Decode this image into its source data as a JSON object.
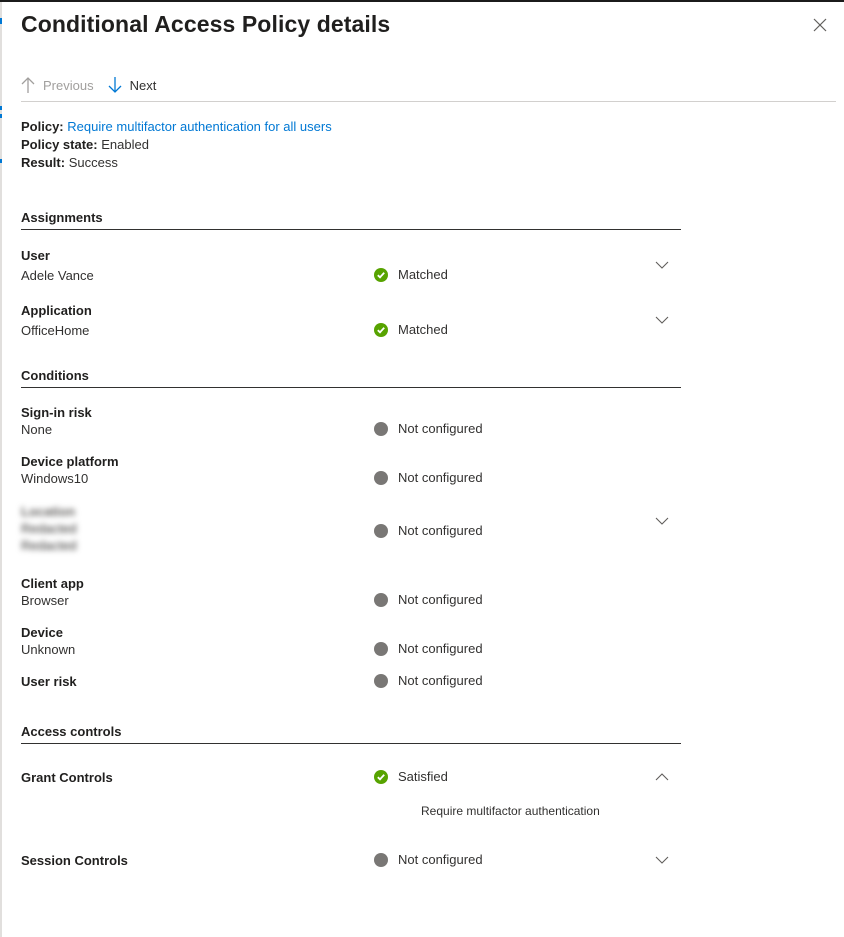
{
  "panel": {
    "title": "Conditional Access Policy details",
    "close_icon": "close-icon"
  },
  "nav": {
    "previous_label": "Previous",
    "previous_icon": "arrow-up-icon",
    "next_label": "Next",
    "next_icon": "arrow-down-icon"
  },
  "summary": {
    "policy_label": "Policy:",
    "policy_value": "Require multifactor authentication for all users",
    "state_label": "Policy state:",
    "state_value": "Enabled",
    "result_label": "Result:",
    "result_value": "Success"
  },
  "colors": {
    "accent": "#0078d4",
    "success": "#57a300",
    "not_configured": "#797775"
  },
  "assignments": {
    "heading": "Assignments",
    "rows": [
      {
        "label": "User",
        "value": "Adele Vance",
        "status": "Matched",
        "status_type": "success",
        "expandable": true,
        "expanded": false
      },
      {
        "label": "Application",
        "value": "OfficeHome",
        "status": "Matched",
        "status_type": "success",
        "expandable": true,
        "expanded": false
      }
    ]
  },
  "conditions": {
    "heading": "Conditions",
    "rows": [
      {
        "label": "Sign-in risk",
        "value": "None",
        "status": "Not configured",
        "status_type": "neutral",
        "expandable": false
      },
      {
        "label": "Device platform",
        "value": "Windows10",
        "status": "Not configured",
        "status_type": "neutral",
        "expandable": false
      },
      {
        "label": "Location",
        "value": "Redacted",
        "value2": "Redacted",
        "redacted": true,
        "status": "Not configured",
        "status_type": "neutral",
        "expandable": true,
        "expanded": false
      },
      {
        "label": "Client app",
        "value": "Browser",
        "status": "Not configured",
        "status_type": "neutral",
        "expandable": false
      },
      {
        "label": "Device",
        "value": "Unknown",
        "status": "Not configured",
        "status_type": "neutral",
        "expandable": false
      },
      {
        "label": "User risk",
        "status": "Not configured",
        "status_type": "neutral",
        "expandable": false
      }
    ]
  },
  "access_controls": {
    "heading": "Access controls",
    "rows": [
      {
        "label": "Grant Controls",
        "status": "Satisfied",
        "status_type": "success",
        "expandable": true,
        "expanded": true,
        "detail": "Require multifactor authentication"
      },
      {
        "label": "Session Controls",
        "status": "Not configured",
        "status_type": "neutral",
        "expandable": true,
        "expanded": false
      }
    ]
  }
}
